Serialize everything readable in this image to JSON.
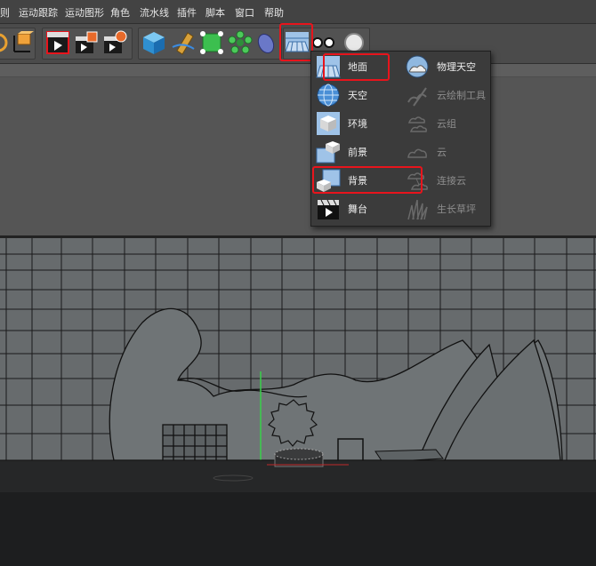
{
  "menu": [
    "则",
    "运动跟踪",
    "运动图形",
    "角色",
    "流水线",
    "插件",
    "脚本",
    "窗口",
    "帮助"
  ],
  "toolbar": {
    "icons": [
      "cube-gizmo-icon",
      "coordinate-axes-icon",
      "render-view-icon",
      "render-picture-viewer-icon",
      "render-settings-icon",
      "cube-icon",
      "pen-tool-icon",
      "subdivision-icon",
      "array-icon",
      "deformer-icon",
      "scene-floor-icon",
      "camera-icon",
      "light-icon"
    ]
  },
  "dropdown": {
    "left": [
      {
        "label": "地面",
        "icon": "floor-icon",
        "enabled": true
      },
      {
        "label": "天空",
        "icon": "sky-icon",
        "enabled": true
      },
      {
        "label": "环境",
        "icon": "environment-icon",
        "enabled": true
      },
      {
        "label": "前景",
        "icon": "foreground-icon",
        "enabled": true
      },
      {
        "label": "背景",
        "icon": "background-icon",
        "enabled": true
      },
      {
        "label": "舞台",
        "icon": "stage-icon",
        "enabled": true
      }
    ],
    "right": [
      {
        "label": "物理天空",
        "icon": "physical-sky-icon",
        "enabled": true
      },
      {
        "label": "云绘制工具",
        "icon": "cloud-paint-icon",
        "enabled": false
      },
      {
        "label": "云组",
        "icon": "cloud-group-icon",
        "enabled": false
      },
      {
        "label": "云",
        "icon": "cloud-icon",
        "enabled": false
      },
      {
        "label": "连接云",
        "icon": "connect-clouds-icon",
        "enabled": false
      },
      {
        "label": "生长草坪",
        "icon": "grass-icon",
        "enabled": false
      }
    ]
  },
  "colors": {
    "highlight": "#e8141c",
    "accent": "#4a8fd6",
    "viewport_bg": "#3f3f3f"
  }
}
